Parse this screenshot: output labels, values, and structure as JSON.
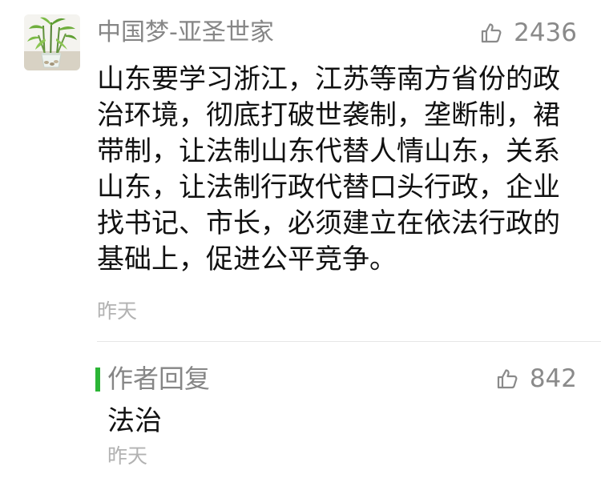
{
  "comment": {
    "author": "中国梦-亚圣世家",
    "likes": "2436",
    "content_lines": [
      "山东要学习浙江，江苏等南方省份的政",
      "治环境，彻底打破世袭制，垄断制，裙",
      "带制，让法制山东代替人情山东，关系",
      "山东，让法制行政代替口头行政，企业",
      "找书记、市长，必须建立在依法行政的",
      "基础上，促进公平竞争。"
    ],
    "time": "昨天",
    "avatar_icon": "bamboo-plant-avatar"
  },
  "reply": {
    "title": "作者回复",
    "likes": "842",
    "content": "法治",
    "time": "昨天",
    "accent_color": "#2bb536"
  },
  "icons": {
    "like": "thumbs-up-icon"
  }
}
